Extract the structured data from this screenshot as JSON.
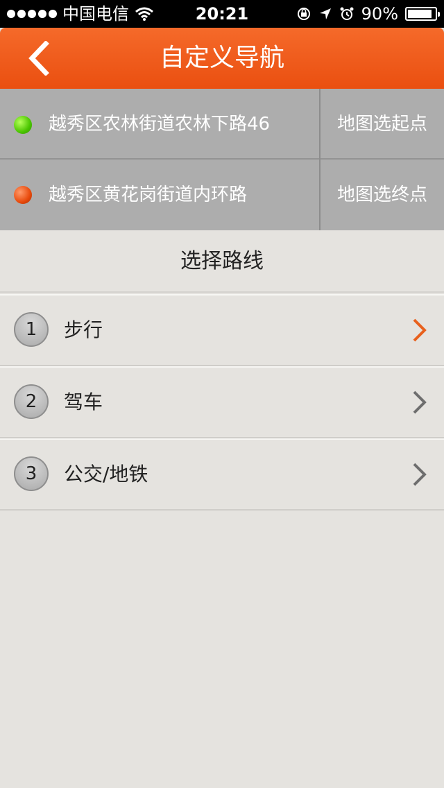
{
  "status_bar": {
    "carrier": "中国电信",
    "time": "20:21",
    "battery_percent": "90%",
    "battery_level": 0.9,
    "icons": [
      "wifi-icon",
      "rotation-lock-icon",
      "location-arrow-icon",
      "alarm-icon",
      "battery-icon"
    ]
  },
  "nav": {
    "title": "自定义导航",
    "back_icon": "back-chevron-icon"
  },
  "locations": {
    "start": {
      "address": "越秀区农林街道农林下路46",
      "map_button": "地图选起点",
      "dot_color": "#4ac500"
    },
    "end": {
      "address": "越秀区黄花岗街道内环路",
      "map_button": "地图选终点",
      "dot_color": "#e84a0c"
    }
  },
  "routes": {
    "header": "选择路线",
    "items": [
      {
        "num": "1",
        "label": "步行",
        "chevron_color": "#e8601c"
      },
      {
        "num": "2",
        "label": "驾车",
        "chevron_color": "#6e6e6e"
      },
      {
        "num": "3",
        "label": "公交/地铁",
        "chevron_color": "#6e6e6e"
      }
    ]
  },
  "colors": {
    "accent": "#ea4f10",
    "panel": "#adadad",
    "background": "#e5e3df"
  }
}
